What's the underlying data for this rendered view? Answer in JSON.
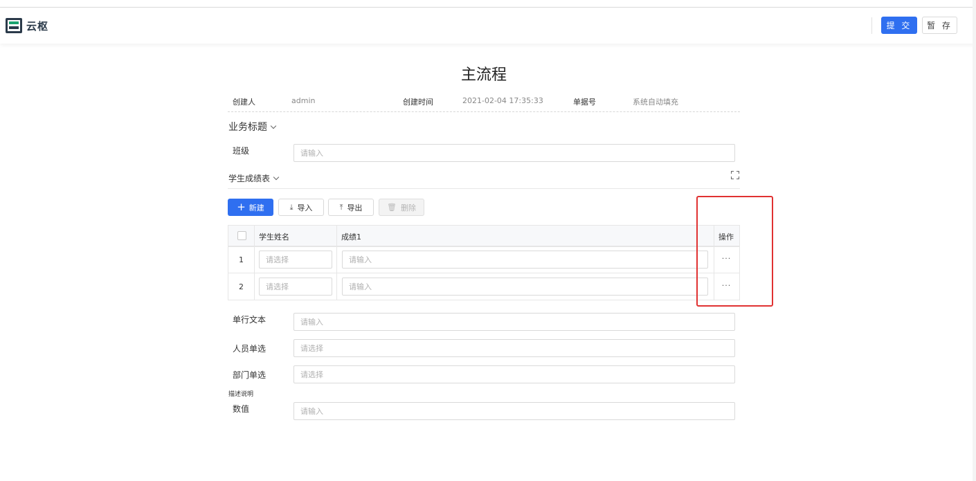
{
  "header": {
    "logo_text": "云枢",
    "submit_label": "提 交",
    "save_label": "暂 存"
  },
  "form": {
    "title": "主流程",
    "meta": {
      "creator_label": "创建人",
      "creator_value": "admin",
      "created_time_label": "创建时间",
      "created_time_value": "2021-02-04 17:35:33",
      "doc_no_label": "单据号",
      "doc_no_value": "系统自动填充"
    },
    "business_title_section": "业务标题",
    "class_label": "班级",
    "class_placeholder": "请输入",
    "subtable": {
      "title": "学生成绩表",
      "toolbar": {
        "new_label": "新建",
        "import_label": "导入",
        "export_label": "导出",
        "delete_label": "删除"
      },
      "columns": [
        "学生姓名",
        "成绩1",
        "操作"
      ],
      "rows": [
        {
          "index": "1",
          "name_placeholder": "请选择",
          "score_placeholder": "请输入",
          "action": "···"
        },
        {
          "index": "2",
          "name_placeholder": "请选择",
          "score_placeholder": "请输入",
          "action": "···"
        }
      ]
    },
    "fields": [
      {
        "label": "单行文本",
        "placeholder": "请输入"
      },
      {
        "label": "人员单选",
        "placeholder": "请选择"
      },
      {
        "label": "部门单选",
        "placeholder": "请选择"
      },
      {
        "label": "数值",
        "placeholder": "请输入"
      }
    ],
    "description_label": "描述说明"
  },
  "colors": {
    "primary": "#2f6ff0",
    "highlight_box": "#e03131"
  }
}
